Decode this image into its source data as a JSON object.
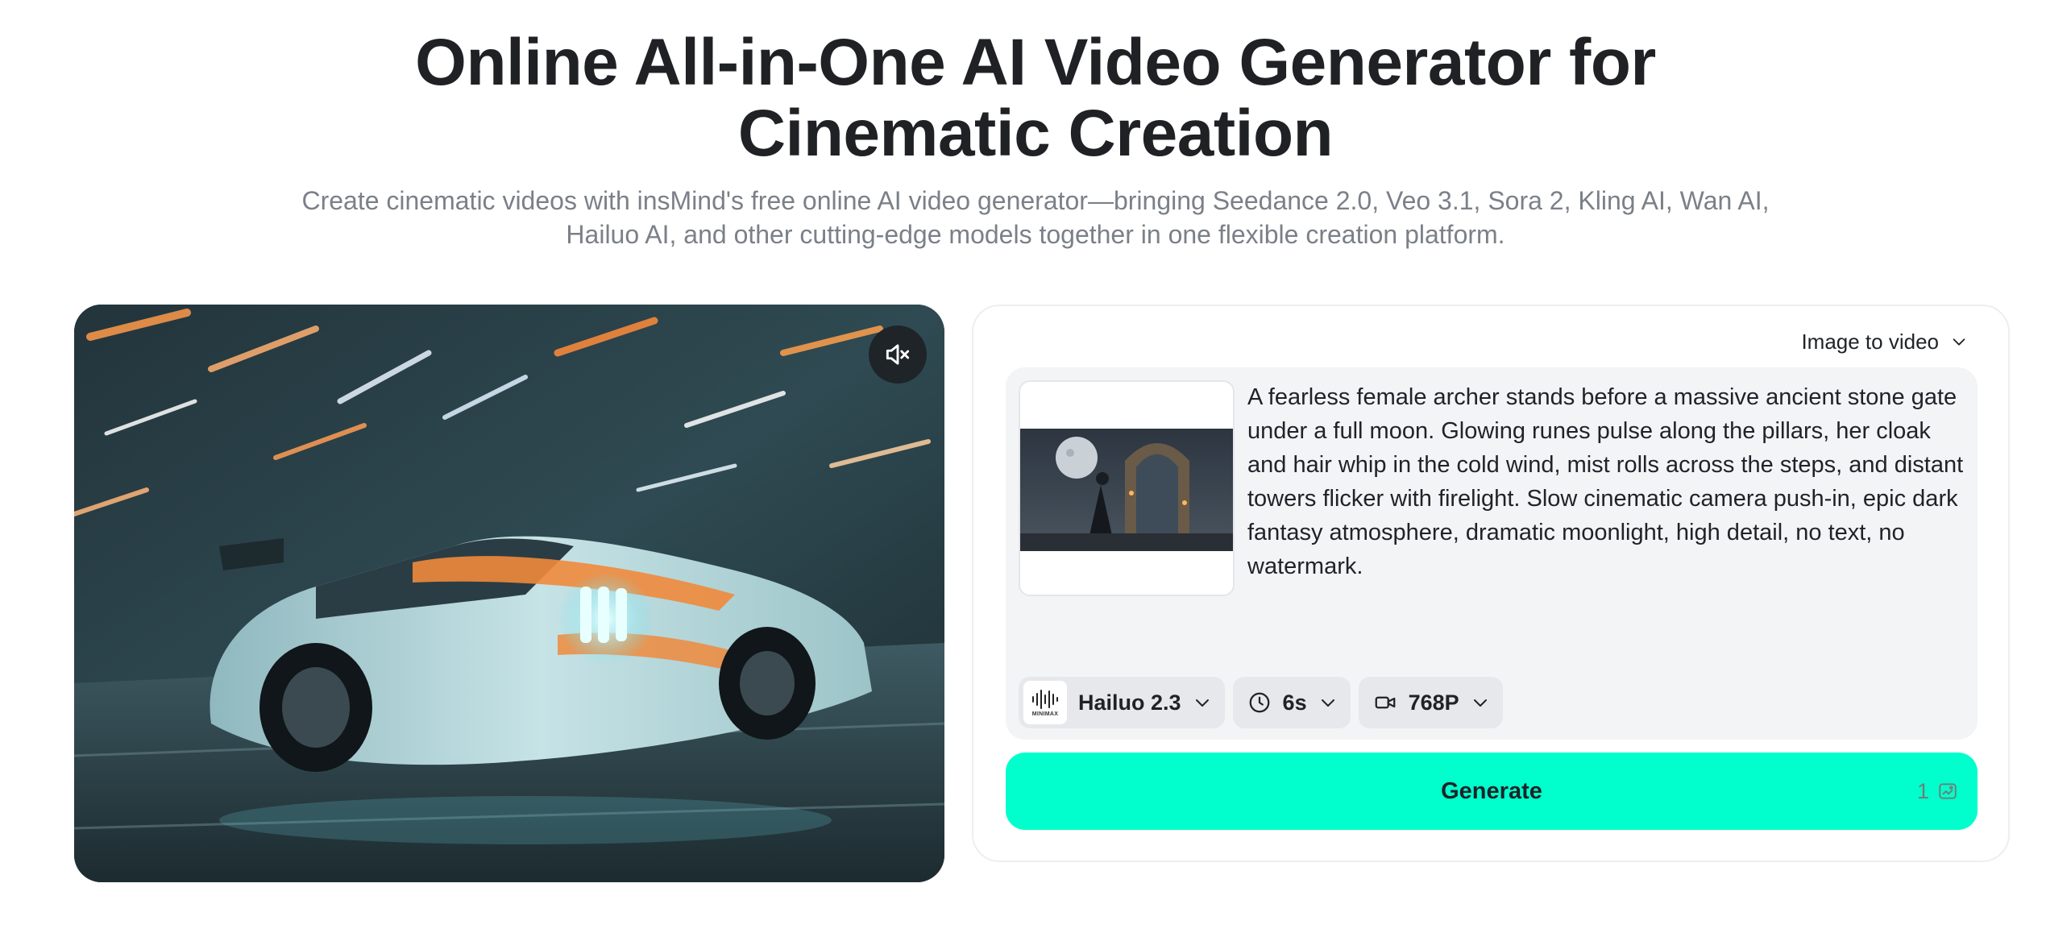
{
  "hero": {
    "title_line1": "Online All-in-One AI Video Generator for",
    "title_line2": "Cinematic Creation",
    "subtitle_line1": "Create cinematic videos with insMind's free online AI video generator—bringing Seedance 2.0, Veo 3.1, Sora 2, Kling AI, Wan AI,",
    "subtitle_line2": "Hailuo AI, and other cutting-edge models together in one flexible creation platform."
  },
  "preview": {
    "sound_icon": "speaker-muted-icon"
  },
  "panel": {
    "mode": "Image to video",
    "prompt": "A fearless female archer stands before a massive ancient stone gate under a full moon. Glowing runes pulse along the pillars, her cloak and hair whip in the cold wind, mist rolls across the steps, and distant towers flicker with firelight. Slow cinematic camera push-in, epic dark fantasy atmosphere, dramatic moonlight, high detail, no text, no watermark.",
    "options": {
      "model_label": "Hailuo 2.3",
      "model_logo_text": "MINIMAX",
      "duration": "6s",
      "resolution": "768P"
    },
    "generate_label": "Generate",
    "credits": "1"
  },
  "colors": {
    "accent": "#00ffcc",
    "title": "#1f2125",
    "subtitle": "#7b8088",
    "prompt_bg": "#f3f4f6"
  }
}
